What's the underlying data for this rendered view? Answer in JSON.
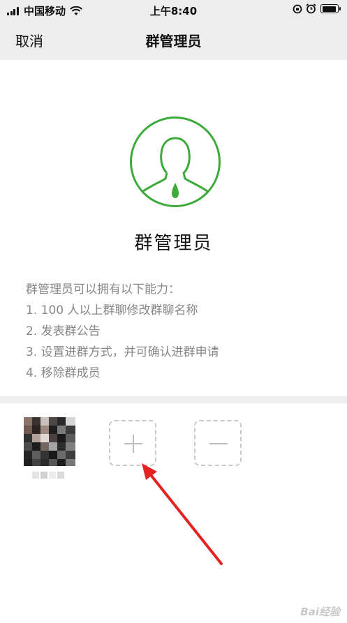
{
  "status_bar": {
    "carrier": "中国移动",
    "time": "上午8:40"
  },
  "nav": {
    "cancel_label": "取消",
    "title": "群管理员"
  },
  "role": {
    "title": "群管理员",
    "description": [
      "群管理员可以拥有以下能力：",
      "1. 100 人以上群聊修改群聊名称",
      "2. 发表群公告",
      "3. 设置进群方式，并可确认进群申请",
      "4. 移除群成员"
    ]
  },
  "colors": {
    "accent_green": "#3dab3b",
    "background_gray": "#ededed",
    "annotation_arrow": "#e52222"
  },
  "watermark": "Bai经验"
}
